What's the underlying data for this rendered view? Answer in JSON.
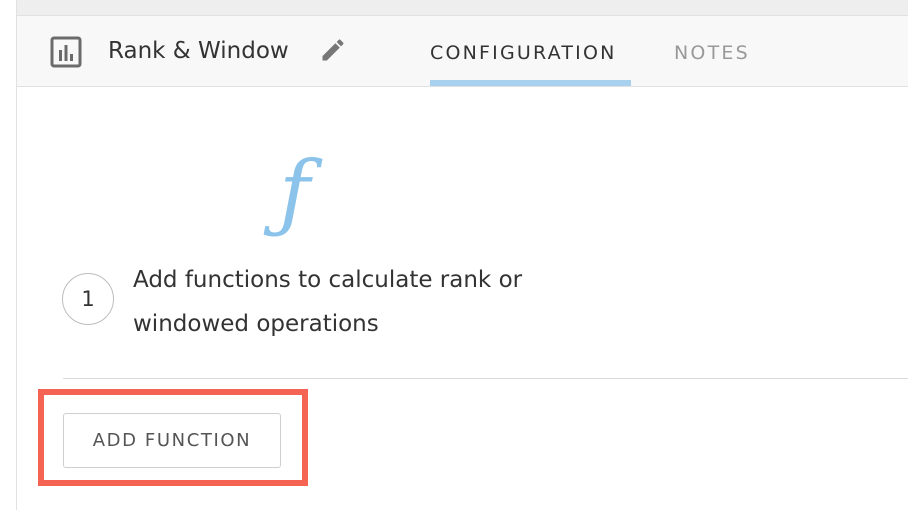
{
  "header": {
    "recipe_name": "Rank & Window",
    "recipe_icon": "bar-chart-icon",
    "edit_icon": "pencil-icon"
  },
  "tabs": [
    {
      "label": "CONFIGURATION",
      "active": true
    },
    {
      "label": "NOTES",
      "active": false
    }
  ],
  "empty_state": {
    "icon": "function-icon",
    "icon_glyph": "ƒ",
    "step_number": "1",
    "step_text": "Add functions to calculate rank or windowed operations"
  },
  "actions": {
    "add_function_label": "ADD FUNCTION"
  },
  "colors": {
    "accent": "#a7d1ef",
    "function_icon": "#8cc3ea",
    "highlight": "#f56352",
    "header_bg": "#f8f8f8"
  }
}
